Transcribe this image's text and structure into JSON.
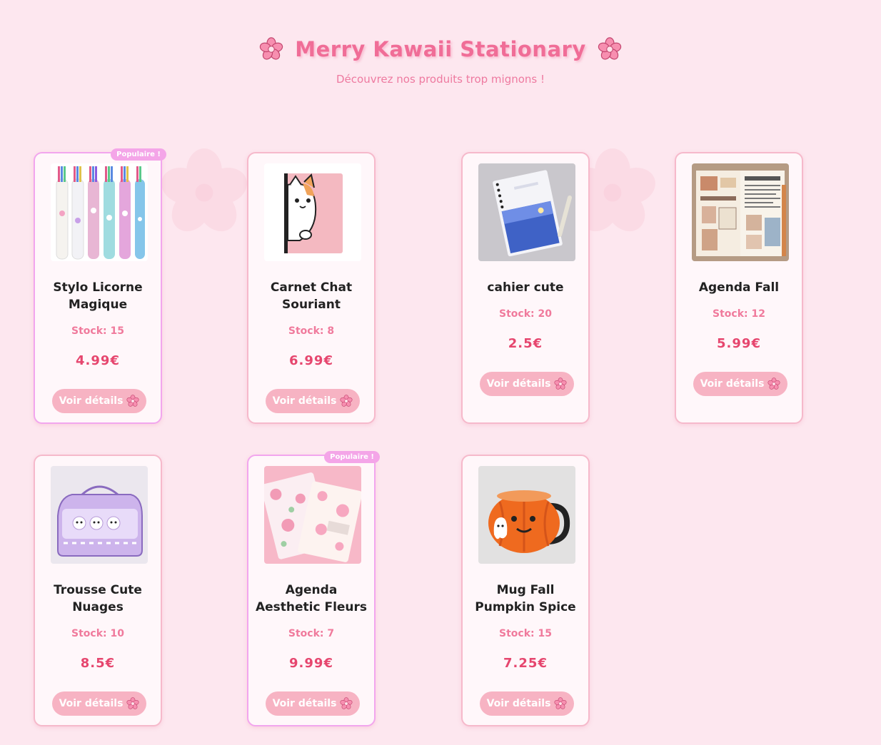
{
  "header": {
    "title": "Merry Kawaii Stationary",
    "subtitle": "Découvrez nos produits trop mignons !"
  },
  "colors": {
    "background": "#fde7ef",
    "accent": "#f06d97",
    "price": "#e6466e",
    "button": "#f7b3c3",
    "badge": "#f4a5e8"
  },
  "products": [
    {
      "name": "Stylo Licorne Magique",
      "stock": "Stock: 15",
      "price": "4.99€",
      "button": "Voir détails",
      "badge": "Populaire !",
      "image": "unicorn-pens-image"
    },
    {
      "name": "Carnet Chat Souriant",
      "stock": "Stock: 8",
      "price": "6.99€",
      "button": "Voir détails",
      "image": "cat-notebook-image"
    },
    {
      "name": "cahier cute",
      "stock": "Stock: 20",
      "price": "2.5€",
      "button": "Voir détails",
      "image": "blue-notebook-image"
    },
    {
      "name": "Agenda Fall",
      "stock": "Stock: 12",
      "price": "5.99€",
      "button": "Voir détails",
      "image": "journal-agenda-image"
    },
    {
      "name": "Trousse Cute Nuages",
      "stock": "Stock: 10",
      "price": "8.5€",
      "button": "Voir détails",
      "image": "pencil-case-image"
    },
    {
      "name": "Agenda Aesthetic Fleurs",
      "stock": "Stock: 7",
      "price": "9.99€",
      "button": "Voir détails",
      "badge": "Populaire !",
      "image": "floral-agenda-image"
    },
    {
      "name": "Mug Fall Pumpkin Spice",
      "stock": "Stock: 15",
      "price": "7.25€",
      "button": "Voir détails",
      "image": "pumpkin-mug-image"
    }
  ]
}
